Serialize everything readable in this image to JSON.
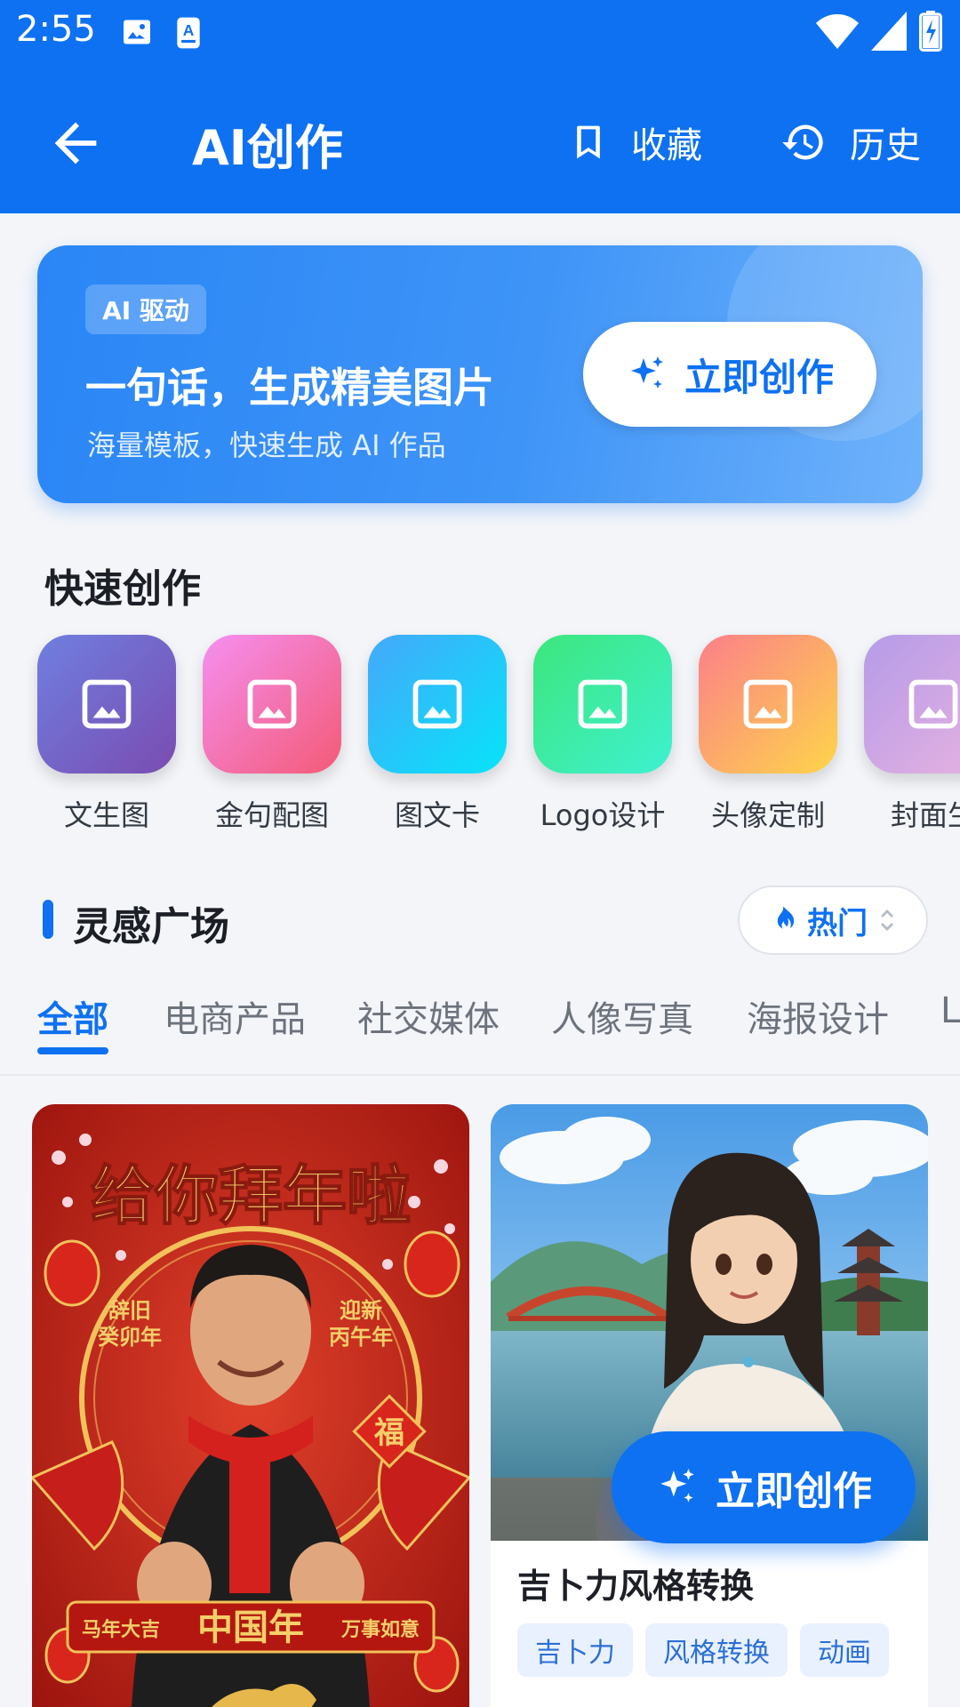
{
  "status_bar": {
    "time": "2:55",
    "left_icons": [
      "image-icon",
      "text-recognition-icon"
    ],
    "right_icons": [
      "wifi-icon",
      "cellular-signal-icon",
      "battery-charging-icon"
    ]
  },
  "header": {
    "back_icon": "arrow-left-icon",
    "title": "AI创作",
    "favorites": {
      "icon": "bookmark-icon",
      "label": "收藏"
    },
    "history": {
      "icon": "history-icon",
      "label": "历史"
    }
  },
  "banner": {
    "badge": "AI 驱动",
    "headline": "一句话，生成精美图片",
    "subtitle": "海量模板，快速生成 AI 作品",
    "cta_label": "立即创作",
    "cta_icon": "sparkle-icon"
  },
  "quick_create": {
    "title": "快速创作",
    "items": [
      {
        "label": "文生图",
        "icon": "image-icon",
        "color_from": "#6f7fe0",
        "color_to": "#7a4cb1"
      },
      {
        "label": "金句配图",
        "icon": "image-icon",
        "color_from": "#f58ff0",
        "color_to": "#f45a76"
      },
      {
        "label": "图文卡",
        "icon": "image-icon",
        "color_from": "#45a8fb",
        "color_to": "#06e4f9"
      },
      {
        "label": "Logo设计",
        "icon": "image-icon",
        "color_from": "#3de67c",
        "color_to": "#3ef1d1"
      },
      {
        "label": "头像定制",
        "icon": "image-icon",
        "color_from": "#fb7f8a",
        "color_to": "#fed54a"
      },
      {
        "label": "封面生",
        "icon": "image-icon",
        "color_from": "#b59be8",
        "color_to": "#e9b3e0"
      }
    ]
  },
  "inspiration": {
    "title": "灵感广场",
    "sort": {
      "icon": "flame-icon",
      "label": "热门",
      "toggle_icon": "chevron-updown-icon"
    },
    "tabs": [
      "全部",
      "电商产品",
      "社交媒体",
      "人像写真",
      "海报设计",
      "L"
    ],
    "active_tab": "全部"
  },
  "cards": {
    "left": {
      "headline": "给你拜年啦",
      "left_banner": "辞旧\n癸卯年",
      "right_banner": "迎新\n丙午年",
      "fu": "福",
      "bottom_left": "马年大吉",
      "bottom_center": "中国年",
      "bottom_right": "万事如意"
    },
    "right": {
      "title": "吉卜力风格转换",
      "tags": [
        "吉卜力",
        "风格转换",
        "动画"
      ]
    }
  },
  "floating_cta": {
    "label": "立即创作",
    "icon": "sparkle-icon"
  },
  "colors": {
    "primary": "#0e71f2",
    "background": "#f3f5f9"
  }
}
